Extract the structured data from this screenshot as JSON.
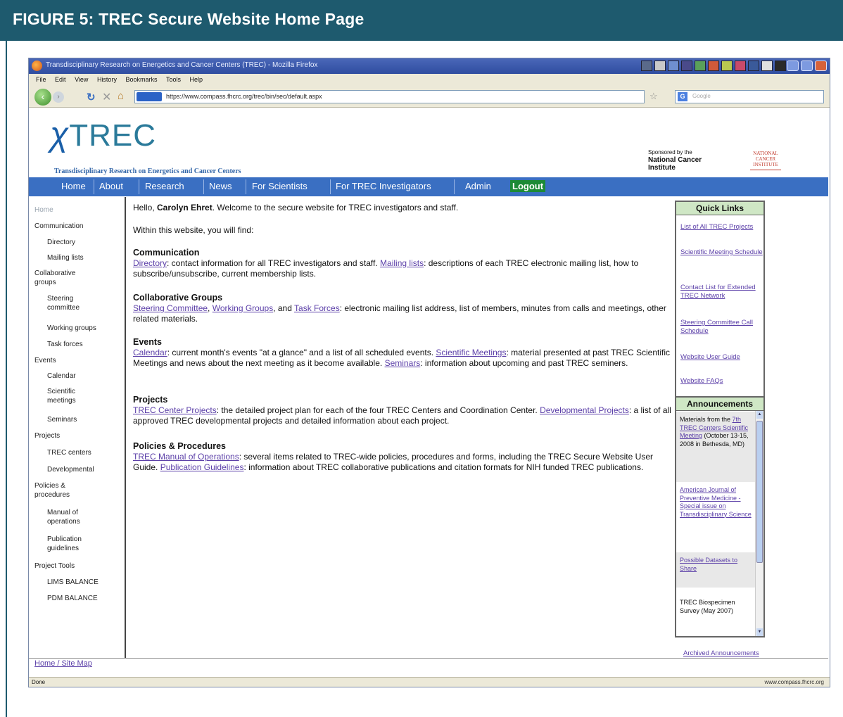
{
  "figure": {
    "title": "FIGURE 5: TREC Secure Website Home Page"
  },
  "browser": {
    "window_title": "Transdisciplinary Research on Energetics and Cancer Centers (TREC) - Mozilla Firefox",
    "menu": [
      "File",
      "Edit",
      "View",
      "History",
      "Bookmarks",
      "Tools",
      "Help"
    ],
    "url": "https://www.compass.fhcrc.org/trec/bin/sec/default.aspx",
    "search_placeholder": "Google",
    "status_left": "Done",
    "status_right": "www.compass.fhcrc.org"
  },
  "site": {
    "logo": "TREC",
    "tagline": "Transdisciplinary Research on Energetics and Cancer Centers",
    "sponsor_line1": "Sponsored by the",
    "sponsor_line2": "National Cancer",
    "sponsor_line3": "Institute",
    "nci_logo": "NATIONAL CANCER INSTITUTE",
    "nav": [
      "Home",
      "About",
      "Research",
      "News",
      "For Scientists",
      "For TREC Investigators",
      "Admin",
      "Logout"
    ]
  },
  "sidebar": {
    "items": [
      "Home",
      "Communication",
      "Directory",
      "Mailing lists",
      "Collaborative groups",
      "Steering committee",
      "Working groups",
      "Task forces",
      "Events",
      "Calendar",
      "Scientific meetings",
      "Seminars",
      "Projects",
      "TREC centers",
      "Developmental",
      "Policies & procedures",
      "Manual of operations",
      "Publication guidelines",
      "Project Tools",
      "LIMS BALANCE",
      "PDM BALANCE"
    ]
  },
  "main": {
    "greeting_prefix": "Hello, ",
    "user_name": "Carolyn Ehret",
    "greeting_suffix": ". Welcome to the secure website for TREC investigators and staff.",
    "intro": "Within this website, you will find:",
    "comm_heading": "Communication",
    "comm_link1": "Directory",
    "comm_text1": ": contact information for all TREC investigators and staff. ",
    "comm_link2": "Mailing lists",
    "comm_text2": ": descriptions of each TREC electronic mailing list, how to subscribe/unsubscribe, current membership lists.",
    "collab_heading": "Collaborative Groups",
    "collab_link1": "Steering Committee",
    "collab_sep1": ", ",
    "collab_link2": "Working Groups",
    "collab_sep2": ", and ",
    "collab_link3": "Task Forces",
    "collab_text": ": electronic mailing list address, list of members, minutes from calls and meetings, other related materials.",
    "events_heading": "Events",
    "events_link1": "Calendar",
    "events_text1": ": current month's events \"at a glance\" and a list of all scheduled events. ",
    "events_link2": "Scientific Meetings",
    "events_text2": ": material presented at past TREC Scientific Meetings and news about the next meeting as it become available. ",
    "events_link3": "Seminars",
    "events_text3": ": information about upcoming and past TREC seminers.",
    "proj_heading": "Projects",
    "proj_link1": "TREC Center Projects",
    "proj_text1": ": the detailed project plan for each of the four TREC Centers and Coordination Center. ",
    "proj_link2": "Developmental Projects",
    "proj_text2": ": a list of all approved TREC developmental projects and detailed information about each project.",
    "pol_heading": "Policies & Procedures",
    "pol_link1": "TREC Manual of Operations",
    "pol_text1": ": several items related to TREC-wide policies, procedures and forms, including the TREC Secure Website User Guide. ",
    "pol_link2": "Publication Guidelines",
    "pol_text2": ": information about TREC collaborative publications and citation formats for NIH funded TREC publications."
  },
  "quick_links": {
    "title": "Quick Links",
    "items": [
      "List of All TREC Projects",
      "Scientific Meeting Schedule",
      "Contact List for Extended TREC Network",
      "Steering Committee Call Schedule",
      "Website User Guide",
      "Website FAQs"
    ]
  },
  "announcements": {
    "title": "Announcements",
    "a1_prefix": "Materials from the ",
    "a1_link": "7th TREC Centers Scientific Meeting",
    "a1_suffix": " (October 13-15, 2008 in Bethesda, MD)",
    "a2": "American Journal of Preventive Medicine - Special issue on Transdisciplinary Science",
    "a3": "Possible Datasets to Share",
    "a4": "TREC Biospecimen Survey (May 2007)",
    "archived": "Archived Announcements"
  },
  "footer": {
    "link": "Home / Site Map"
  }
}
